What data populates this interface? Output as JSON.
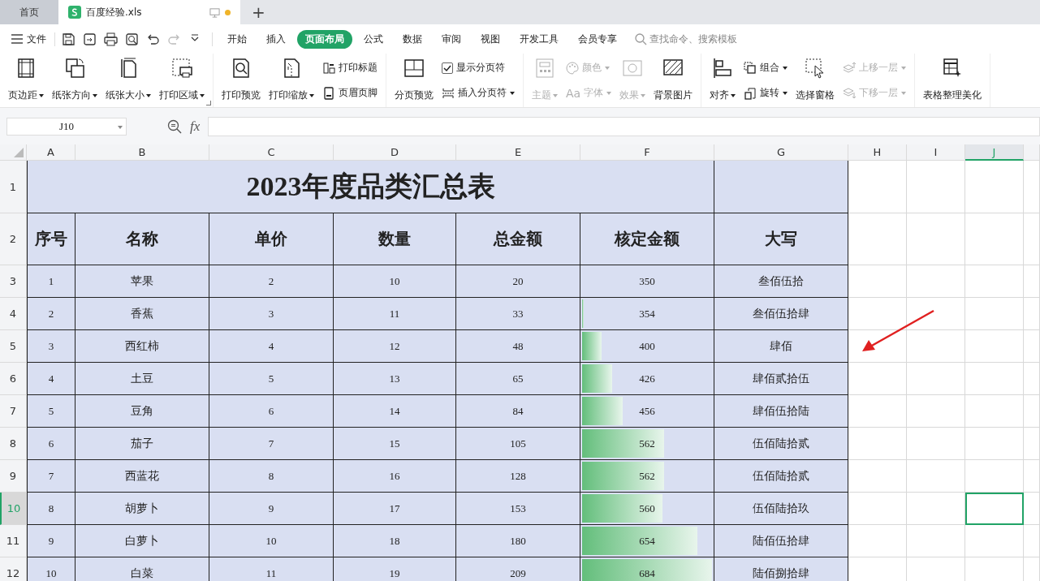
{
  "tabs": [
    {
      "label": "首页",
      "kind": "home",
      "selected": false
    },
    {
      "label": "百度经验.xls",
      "kind": "file",
      "selected": true
    }
  ],
  "new_tab": "+",
  "menu": {
    "file": "文件",
    "tabs": [
      {
        "label": "开始",
        "selected": false
      },
      {
        "label": "插入",
        "selected": false
      },
      {
        "label": "页面布局",
        "selected": true
      },
      {
        "label": "公式",
        "selected": false
      },
      {
        "label": "数据",
        "selected": false
      },
      {
        "label": "审阅",
        "selected": false
      },
      {
        "label": "视图",
        "selected": false
      },
      {
        "label": "开发工具",
        "selected": false
      },
      {
        "label": "会员专享",
        "selected": false
      }
    ],
    "search": {
      "placeholder": "查找命令、搜索模板"
    }
  },
  "ribbon": [
    {
      "items": [
        {
          "kind": "large",
          "label": "页边距",
          "dropdown": true,
          "disabled": false
        },
        {
          "kind": "large",
          "label": "纸张方向",
          "dropdown": true,
          "disabled": false
        },
        {
          "kind": "large",
          "label": "纸张大小",
          "dropdown": true,
          "disabled": false
        },
        {
          "kind": "large",
          "label": "打印区域",
          "dropdown": true,
          "disabled": false
        }
      ]
    },
    {
      "items": [
        {
          "kind": "large",
          "label": "打印预览",
          "dropdown": false,
          "disabled": false
        },
        {
          "kind": "large",
          "label": "打印缩放",
          "dropdown": true,
          "disabled": false
        },
        {
          "kind": "stack",
          "items": [
            {
              "kind": "small",
              "label": "打印标题",
              "dropdown": false,
              "disabled": false
            },
            {
              "kind": "small",
              "label": "页眉页脚",
              "dropdown": false,
              "disabled": false
            }
          ]
        }
      ]
    },
    {
      "items": [
        {
          "kind": "large",
          "label": "分页预览",
          "dropdown": false,
          "disabled": false
        },
        {
          "kind": "stack",
          "items": [
            {
              "kind": "check",
              "label": "显示分页符",
              "checked": true
            },
            {
              "kind": "small",
              "label": "插入分页符",
              "dropdown": true,
              "disabled": false
            }
          ]
        }
      ]
    },
    {
      "items": [
        {
          "kind": "large",
          "label": "主题",
          "dropdown": true,
          "disabled": true
        },
        {
          "kind": "stack",
          "items": [
            {
              "kind": "small",
              "label": "颜色",
              "dropdown": true,
              "disabled": true
            },
            {
              "kind": "small",
              "glyph": "Aa",
              "label": "字体",
              "dropdown": true,
              "disabled": true
            }
          ]
        },
        {
          "kind": "large",
          "label": "效果",
          "dropdown": true,
          "disabled": true
        },
        {
          "kind": "large",
          "label": "背景图片",
          "dropdown": false,
          "disabled": false
        }
      ]
    },
    {
      "items": [
        {
          "kind": "large",
          "label": "对齐",
          "dropdown": true,
          "disabled": false
        },
        {
          "kind": "stack",
          "items": [
            {
              "kind": "small",
              "label": "组合",
              "dropdown": true,
              "disabled": false
            },
            {
              "kind": "small",
              "label": "旋转",
              "dropdown": true,
              "disabled": false
            }
          ]
        },
        {
          "kind": "large",
          "label": "选择窗格",
          "dropdown": false,
          "disabled": false
        },
        {
          "kind": "stack",
          "items": [
            {
              "kind": "small",
              "label": "上移一层",
              "dropdown": true,
              "disabled": true
            },
            {
              "kind": "small",
              "label": "下移一层",
              "dropdown": true,
              "disabled": true
            }
          ]
        }
      ]
    },
    {
      "items": [
        {
          "kind": "large",
          "label": "表格整理美化",
          "dropdown": false,
          "disabled": false
        }
      ]
    }
  ],
  "formula_bar": {
    "name_box": "J10",
    "fx": "fx"
  },
  "sheet": {
    "columns": [
      {
        "label": "A",
        "selected": false
      },
      {
        "label": "B",
        "selected": false
      },
      {
        "label": "C",
        "selected": false
      },
      {
        "label": "D",
        "selected": false
      },
      {
        "label": "E",
        "selected": false
      },
      {
        "label": "F",
        "selected": false
      },
      {
        "label": "G",
        "selected": false
      },
      {
        "label": "H",
        "selected": false
      },
      {
        "label": "I",
        "selected": false
      },
      {
        "label": "J",
        "selected": true
      }
    ],
    "rows": [
      {
        "label": "1",
        "selected": false
      },
      {
        "label": "2",
        "selected": false
      },
      {
        "label": "3",
        "selected": false
      },
      {
        "label": "4",
        "selected": false
      },
      {
        "label": "5",
        "selected": false
      },
      {
        "label": "6",
        "selected": false
      },
      {
        "label": "7",
        "selected": false
      },
      {
        "label": "8",
        "selected": false
      },
      {
        "label": "9",
        "selected": false
      },
      {
        "label": "10",
        "selected": true
      },
      {
        "label": "11",
        "selected": false
      },
      {
        "label": "12",
        "selected": false
      }
    ],
    "title": "2023年度品类汇总表",
    "headers": [
      "序号",
      "名称",
      "单价",
      "数量",
      "总金额",
      "核定金额",
      "大写"
    ],
    "records": [
      {
        "cells": [
          "1",
          "苹果",
          "2",
          "10",
          "20",
          "350",
          "叁佰伍拾"
        ]
      },
      {
        "cells": [
          "2",
          "香蕉",
          "3",
          "11",
          "33",
          "354",
          "叁佰伍拾肆"
        ],
        "level": 0.01
      },
      {
        "cells": [
          "3",
          "西红柿",
          "4",
          "12",
          "48",
          "400",
          "肆佰"
        ],
        "level": 0.15
      },
      {
        "cells": [
          "4",
          "土豆",
          "5",
          "13",
          "65",
          "426",
          "肆佰贰拾伍"
        ],
        "level": 0.23
      },
      {
        "cells": [
          "5",
          "豆角",
          "6",
          "14",
          "84",
          "456",
          "肆佰伍拾陆"
        ],
        "level": 0.31
      },
      {
        "cells": [
          "6",
          "茄子",
          "7",
          "15",
          "105",
          "562",
          "伍佰陆拾贰"
        ],
        "level": 0.63
      },
      {
        "cells": [
          "7",
          "西蓝花",
          "8",
          "16",
          "128",
          "562",
          "伍佰陆拾贰"
        ],
        "level": 0.63
      },
      {
        "cells": [
          "8",
          "胡萝卜",
          "9",
          "17",
          "153",
          "560",
          "伍佰陆拾玖"
        ],
        "level": 0.62
      },
      {
        "cells": [
          "9",
          "白萝卜",
          "10",
          "18",
          "180",
          "654",
          "陆佰伍拾肆"
        ],
        "level": 0.89
      },
      {
        "cells": [
          "10",
          "白菜",
          "11",
          "19",
          "209",
          "684",
          "陆佰捌拾肆"
        ],
        "level": 1
      }
    ]
  }
}
